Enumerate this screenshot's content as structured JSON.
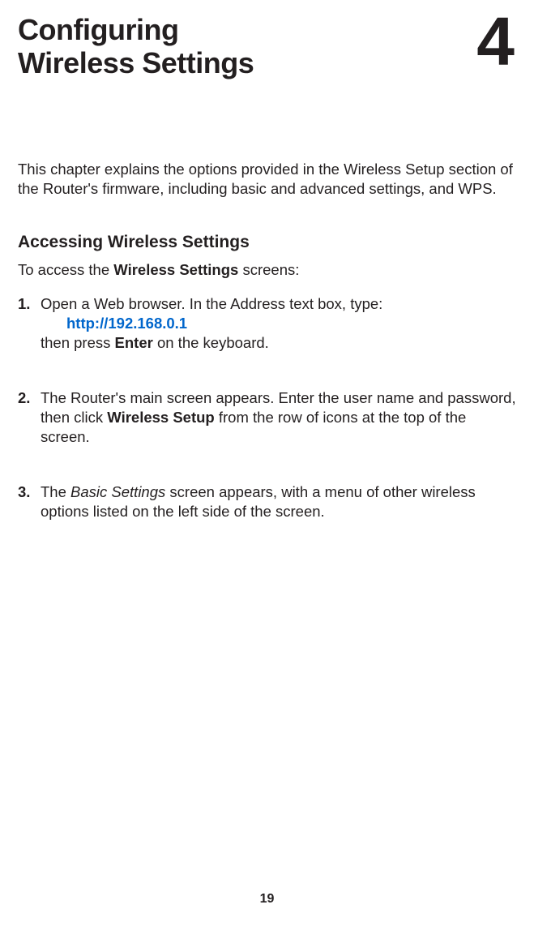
{
  "header": {
    "title_line1": "Configuring",
    "title_line2": "Wireless Settings",
    "chapter_number": "4"
  },
  "intro": "This chapter explains the options provided in the Wireless Setup section of the Router's firmware, including basic and advanced settings, and WPS.",
  "section": {
    "heading": "Accessing Wireless Settings",
    "intro_prefix": "To access the ",
    "intro_bold": "Wireless Settings",
    "intro_suffix": " screens:"
  },
  "steps": {
    "s1": {
      "num": "1.",
      "line1": "Open a Web browser. In the Address text box, type:",
      "url": "http://192.168.0.1",
      "line2a": "then press ",
      "line2b": "Enter",
      "line2c": " on the keyboard."
    },
    "s2": {
      "num": "2.",
      "text1": "The Router's main screen appears. Enter the user name and password, then click ",
      "bold": "Wireless Setup",
      "text2": " from the row of icons at the top of the screen."
    },
    "s3": {
      "num": "3.",
      "text1": "The ",
      "italic": "Basic Settings",
      "text2": " screen appears, with a menu of other wireless options listed on the left side of the screen."
    }
  },
  "page_number": "19"
}
